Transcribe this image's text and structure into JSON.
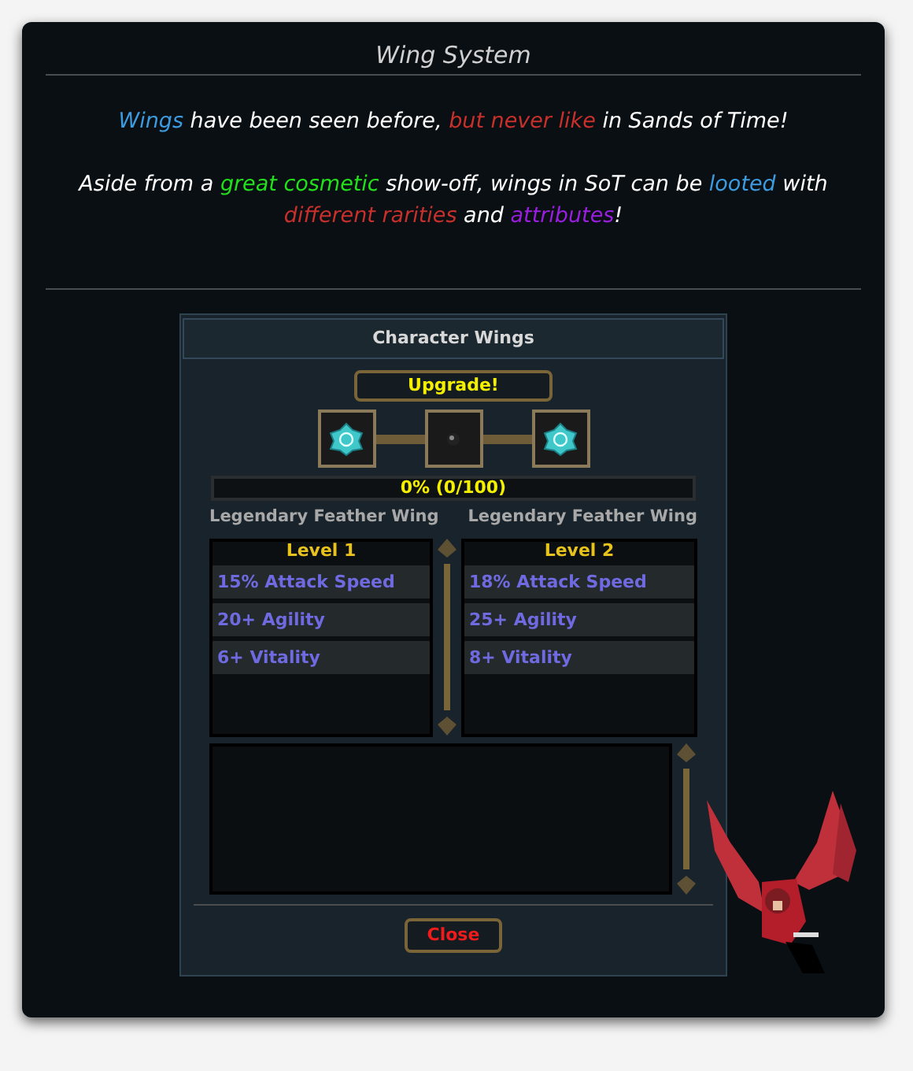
{
  "window": {
    "title": "Wing System"
  },
  "intro": [
    {
      "segments": [
        {
          "text": "Wings",
          "color": "#3d9be0"
        },
        {
          "text": " have been seen before, ",
          "color": "#ffffff"
        },
        {
          "text": "but never like",
          "color": "#c8302c"
        },
        {
          "text": " in Sands of Time!",
          "color": "#ffffff"
        }
      ]
    },
    {
      "segments": [
        {
          "text": "Aside from a ",
          "color": "#ffffff"
        },
        {
          "text": "great cosmetic",
          "color": "#22e01c"
        },
        {
          "text": " show-off, wings in SoT can be ",
          "color": "#ffffff"
        },
        {
          "text": "looted",
          "color": "#3d9be0"
        },
        {
          "text": " with ",
          "color": "#ffffff"
        },
        {
          "text": "different rarities",
          "color": "#c8302c"
        },
        {
          "text": " and ",
          "color": "#ffffff"
        },
        {
          "text": "attributes",
          "color": "#9a1ee0"
        },
        {
          "text": "!",
          "color": "#ffffff"
        }
      ]
    }
  ],
  "panel": {
    "title": "Character Wings",
    "upgrade_button": "Upgrade!",
    "slots": [
      {
        "kind": "gem"
      },
      {
        "kind": "orb"
      },
      {
        "kind": "gem"
      }
    ],
    "progress": {
      "level": 0,
      "reading": "0% (0/100)"
    },
    "wings": [
      {
        "name": "Legendary Feather Wing",
        "level": "Level 1",
        "attributes": [
          "15% Attack Speed",
          "20+ Agility",
          "6+ Vitality"
        ]
      },
      {
        "name": "Legendary Feather Wing",
        "level": "Level 2",
        "attributes": [
          "18% Attack Speed",
          "25+ Agility",
          "8+ Vitality"
        ]
      }
    ],
    "close_button": "Close"
  }
}
